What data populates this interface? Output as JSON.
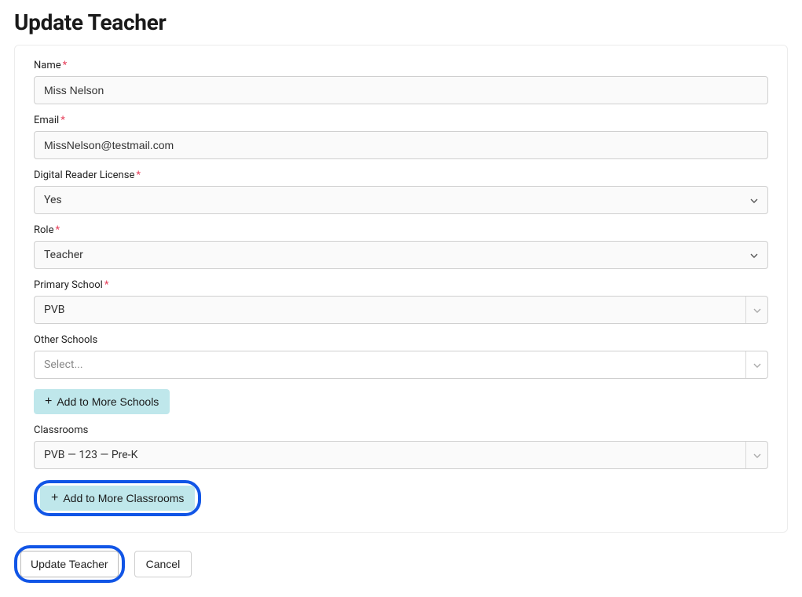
{
  "page": {
    "title": "Update Teacher"
  },
  "form": {
    "name": {
      "label": "Name",
      "value": "Miss Nelson"
    },
    "email": {
      "label": "Email",
      "value": "MissNelson@testmail.com"
    },
    "license": {
      "label": "Digital Reader License",
      "value": "Yes"
    },
    "role": {
      "label": "Role",
      "value": "Teacher"
    },
    "primary_school": {
      "label": "Primary School",
      "value": "PVB"
    },
    "other_schools": {
      "label": "Other Schools",
      "placeholder": "Select..."
    },
    "add_more_schools": "Add to More Schools",
    "classrooms": {
      "label": "Classrooms",
      "value": "PVB — 123 — Pre-K"
    },
    "add_more_classrooms": "Add to More Classrooms"
  },
  "footer": {
    "submit": "Update Teacher",
    "cancel": "Cancel"
  }
}
